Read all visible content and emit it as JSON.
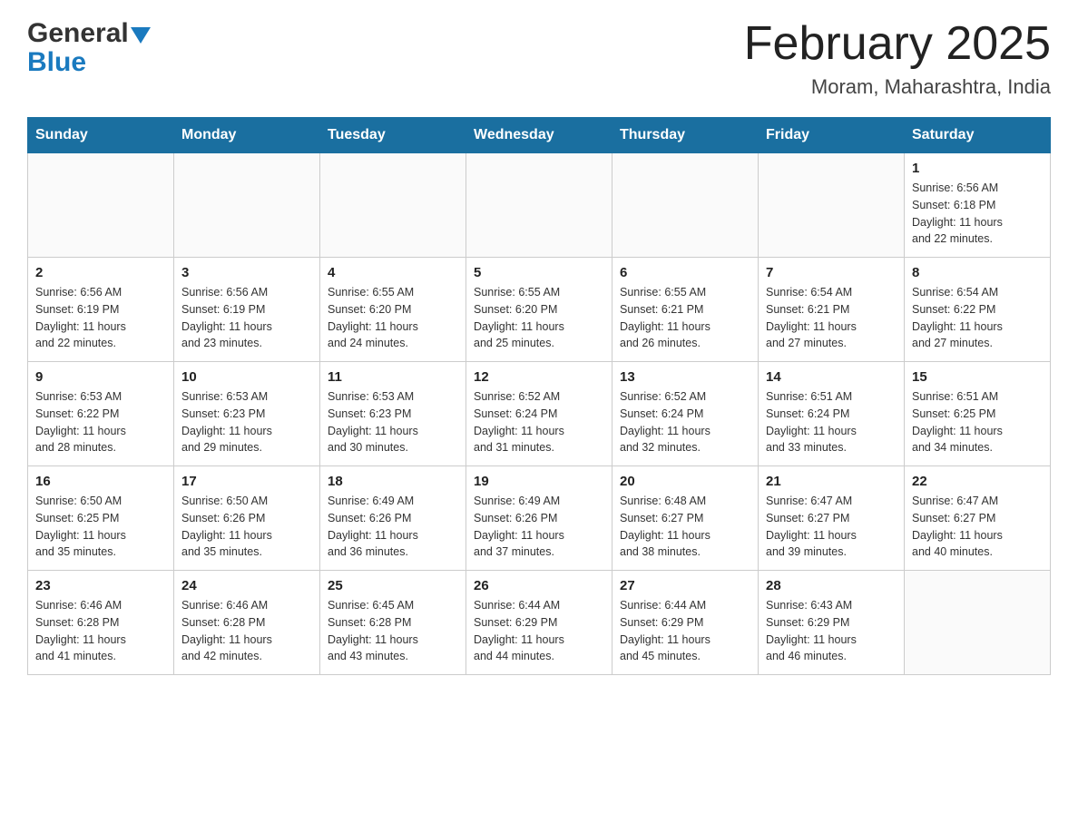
{
  "header": {
    "logo": {
      "general": "General",
      "blue": "Blue",
      "arrow_color": "#1a7abf"
    },
    "title": "February 2025",
    "subtitle": "Moram, Maharashtra, India"
  },
  "days_of_week": [
    "Sunday",
    "Monday",
    "Tuesday",
    "Wednesday",
    "Thursday",
    "Friday",
    "Saturday"
  ],
  "weeks": [
    {
      "days": [
        {
          "number": "",
          "info": ""
        },
        {
          "number": "",
          "info": ""
        },
        {
          "number": "",
          "info": ""
        },
        {
          "number": "",
          "info": ""
        },
        {
          "number": "",
          "info": ""
        },
        {
          "number": "",
          "info": ""
        },
        {
          "number": "1",
          "info": "Sunrise: 6:56 AM\nSunset: 6:18 PM\nDaylight: 11 hours\nand 22 minutes."
        }
      ]
    },
    {
      "days": [
        {
          "number": "2",
          "info": "Sunrise: 6:56 AM\nSunset: 6:19 PM\nDaylight: 11 hours\nand 22 minutes."
        },
        {
          "number": "3",
          "info": "Sunrise: 6:56 AM\nSunset: 6:19 PM\nDaylight: 11 hours\nand 23 minutes."
        },
        {
          "number": "4",
          "info": "Sunrise: 6:55 AM\nSunset: 6:20 PM\nDaylight: 11 hours\nand 24 minutes."
        },
        {
          "number": "5",
          "info": "Sunrise: 6:55 AM\nSunset: 6:20 PM\nDaylight: 11 hours\nand 25 minutes."
        },
        {
          "number": "6",
          "info": "Sunrise: 6:55 AM\nSunset: 6:21 PM\nDaylight: 11 hours\nand 26 minutes."
        },
        {
          "number": "7",
          "info": "Sunrise: 6:54 AM\nSunset: 6:21 PM\nDaylight: 11 hours\nand 27 minutes."
        },
        {
          "number": "8",
          "info": "Sunrise: 6:54 AM\nSunset: 6:22 PM\nDaylight: 11 hours\nand 27 minutes."
        }
      ]
    },
    {
      "days": [
        {
          "number": "9",
          "info": "Sunrise: 6:53 AM\nSunset: 6:22 PM\nDaylight: 11 hours\nand 28 minutes."
        },
        {
          "number": "10",
          "info": "Sunrise: 6:53 AM\nSunset: 6:23 PM\nDaylight: 11 hours\nand 29 minutes."
        },
        {
          "number": "11",
          "info": "Sunrise: 6:53 AM\nSunset: 6:23 PM\nDaylight: 11 hours\nand 30 minutes."
        },
        {
          "number": "12",
          "info": "Sunrise: 6:52 AM\nSunset: 6:24 PM\nDaylight: 11 hours\nand 31 minutes."
        },
        {
          "number": "13",
          "info": "Sunrise: 6:52 AM\nSunset: 6:24 PM\nDaylight: 11 hours\nand 32 minutes."
        },
        {
          "number": "14",
          "info": "Sunrise: 6:51 AM\nSunset: 6:24 PM\nDaylight: 11 hours\nand 33 minutes."
        },
        {
          "number": "15",
          "info": "Sunrise: 6:51 AM\nSunset: 6:25 PM\nDaylight: 11 hours\nand 34 minutes."
        }
      ]
    },
    {
      "days": [
        {
          "number": "16",
          "info": "Sunrise: 6:50 AM\nSunset: 6:25 PM\nDaylight: 11 hours\nand 35 minutes."
        },
        {
          "number": "17",
          "info": "Sunrise: 6:50 AM\nSunset: 6:26 PM\nDaylight: 11 hours\nand 35 minutes."
        },
        {
          "number": "18",
          "info": "Sunrise: 6:49 AM\nSunset: 6:26 PM\nDaylight: 11 hours\nand 36 minutes."
        },
        {
          "number": "19",
          "info": "Sunrise: 6:49 AM\nSunset: 6:26 PM\nDaylight: 11 hours\nand 37 minutes."
        },
        {
          "number": "20",
          "info": "Sunrise: 6:48 AM\nSunset: 6:27 PM\nDaylight: 11 hours\nand 38 minutes."
        },
        {
          "number": "21",
          "info": "Sunrise: 6:47 AM\nSunset: 6:27 PM\nDaylight: 11 hours\nand 39 minutes."
        },
        {
          "number": "22",
          "info": "Sunrise: 6:47 AM\nSunset: 6:27 PM\nDaylight: 11 hours\nand 40 minutes."
        }
      ]
    },
    {
      "days": [
        {
          "number": "23",
          "info": "Sunrise: 6:46 AM\nSunset: 6:28 PM\nDaylight: 11 hours\nand 41 minutes."
        },
        {
          "number": "24",
          "info": "Sunrise: 6:46 AM\nSunset: 6:28 PM\nDaylight: 11 hours\nand 42 minutes."
        },
        {
          "number": "25",
          "info": "Sunrise: 6:45 AM\nSunset: 6:28 PM\nDaylight: 11 hours\nand 43 minutes."
        },
        {
          "number": "26",
          "info": "Sunrise: 6:44 AM\nSunset: 6:29 PM\nDaylight: 11 hours\nand 44 minutes."
        },
        {
          "number": "27",
          "info": "Sunrise: 6:44 AM\nSunset: 6:29 PM\nDaylight: 11 hours\nand 45 minutes."
        },
        {
          "number": "28",
          "info": "Sunrise: 6:43 AM\nSunset: 6:29 PM\nDaylight: 11 hours\nand 46 minutes."
        },
        {
          "number": "",
          "info": ""
        }
      ]
    }
  ]
}
